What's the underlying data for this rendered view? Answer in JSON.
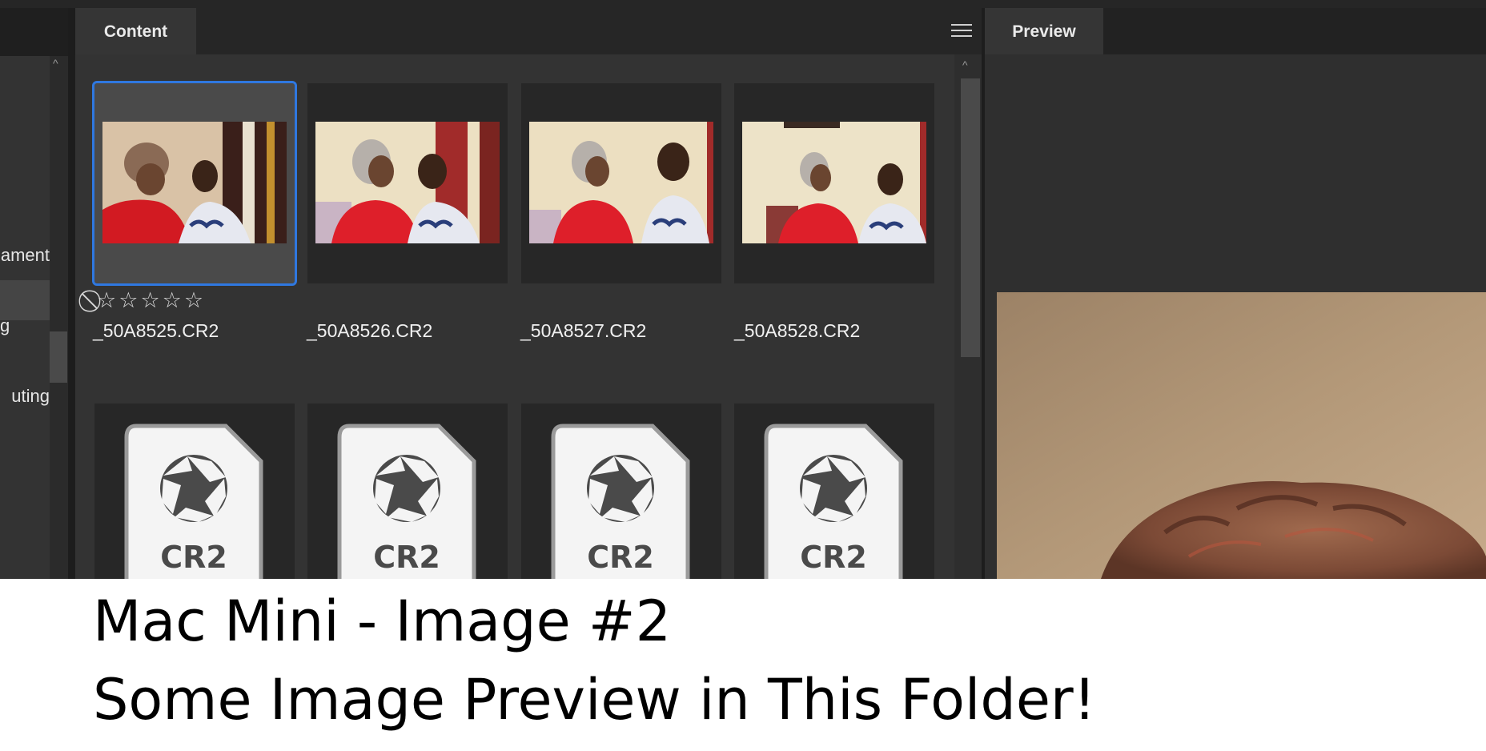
{
  "left_panel": {
    "items": [
      {
        "label": "ament"
      },
      {
        "label": "g"
      },
      {
        "label": "uting"
      }
    ]
  },
  "content": {
    "tab_label": "Content",
    "menu_icon": "hamburger-menu-icon",
    "selection_color": "#2f78e0",
    "files": [
      {
        "name": "_50A8525.CR2",
        "selected": true,
        "rating": 0
      },
      {
        "name": "_50A8526.CR2",
        "selected": false
      },
      {
        "name": "_50A8527.CR2",
        "selected": false
      },
      {
        "name": "_50A8528.CR2",
        "selected": false
      }
    ],
    "raw_placeholders": [
      {
        "badge": "CR2"
      },
      {
        "badge": "CR2"
      },
      {
        "badge": "CR2"
      },
      {
        "badge": "CR2"
      }
    ]
  },
  "preview": {
    "tab_label": "Preview"
  },
  "caption": {
    "line1": "Mac Mini - Image #2",
    "line2": "Some Image Preview in This Folder!"
  }
}
